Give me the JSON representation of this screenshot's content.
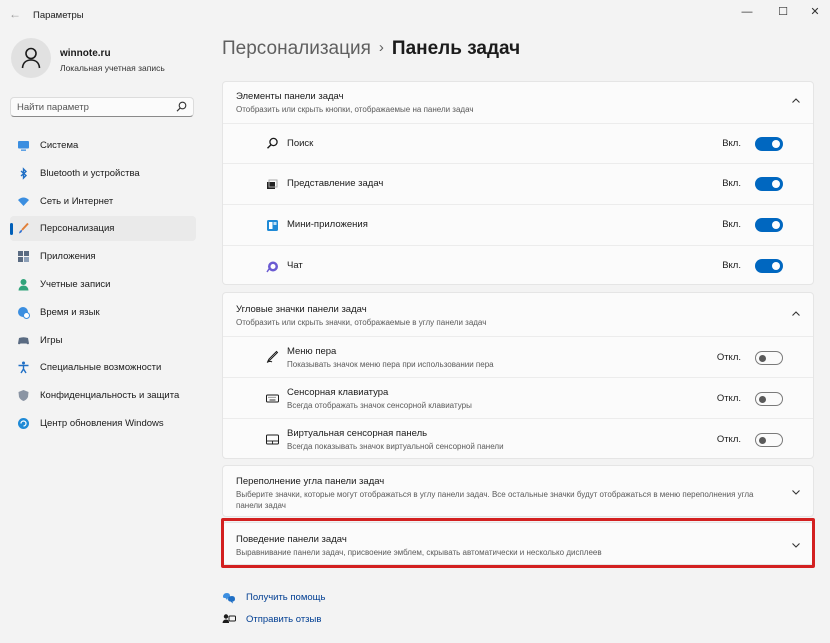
{
  "window": {
    "title": "Параметры",
    "controls": {
      "minimize": "—",
      "maximize": "☐",
      "close": "✕"
    }
  },
  "profile": {
    "name": "winnote.ru",
    "account_type": "Локальная учетная запись"
  },
  "search": {
    "placeholder": "Найти параметр"
  },
  "sidebar": {
    "items": [
      {
        "label": "Система",
        "icon": "system-icon"
      },
      {
        "label": "Bluetooth и устройства",
        "icon": "bluetooth-icon"
      },
      {
        "label": "Сеть и Интернет",
        "icon": "wifi-icon"
      },
      {
        "label": "Персонализация",
        "icon": "brush-icon",
        "active": true
      },
      {
        "label": "Приложения",
        "icon": "apps-icon"
      },
      {
        "label": "Учетные записи",
        "icon": "accounts-icon"
      },
      {
        "label": "Время и язык",
        "icon": "globe-clock-icon"
      },
      {
        "label": "Игры",
        "icon": "gamepad-icon"
      },
      {
        "label": "Специальные возможности",
        "icon": "accessibility-icon"
      },
      {
        "label": "Конфиденциальность и защита",
        "icon": "shield-icon"
      },
      {
        "label": "Центр обновления Windows",
        "icon": "update-icon"
      }
    ]
  },
  "breadcrumb": {
    "parent": "Персонализация",
    "separator": "›",
    "current": "Панель задач"
  },
  "sections": {
    "taskbar_items": {
      "title": "Элементы панели задач",
      "description": "Отобразить или скрыть кнопки, отображаемые на панели задач",
      "rows": [
        {
          "label": "Поиск",
          "state": "Вкл.",
          "on": true,
          "icon": "search-icon"
        },
        {
          "label": "Представление задач",
          "state": "Вкл.",
          "on": true,
          "icon": "task-view-icon"
        },
        {
          "label": "Мини-приложения",
          "state": "Вкл.",
          "on": true,
          "icon": "widgets-icon"
        },
        {
          "label": "Чат",
          "state": "Вкл.",
          "on": true,
          "icon": "chat-icon"
        }
      ]
    },
    "corner_icons": {
      "title": "Угловые значки панели задач",
      "description": "Отобразить или скрыть значки, отображаемые в углу панели задач",
      "rows": [
        {
          "label": "Меню пера",
          "description": "Показывать значок меню пера при использовании пера",
          "state": "Откл.",
          "on": false,
          "icon": "pen-icon"
        },
        {
          "label": "Сенсорная клавиатура",
          "description": "Всегда отображать значок сенсорной клавиатуры",
          "state": "Откл.",
          "on": false,
          "icon": "keyboard-icon"
        },
        {
          "label": "Виртуальная сенсорная панель",
          "description": "Всегда показывать значок виртуальной сенсорной панели",
          "state": "Откл.",
          "on": false,
          "icon": "touchpad-icon"
        }
      ]
    },
    "corner_overflow": {
      "title": "Переполнение угла панели задач",
      "description": "Выберите значки, которые могут отображаться в углу панели задач. Все остальные значки будут отображаться в меню переполнения угла панели задач"
    },
    "behaviors": {
      "title": "Поведение панели задач",
      "description": "Выравнивание панели задач, присвоение эмблем, скрывать автоматически и несколько дисплеев"
    }
  },
  "footer": {
    "help": "Получить помощь",
    "feedback": "Отправить отзыв"
  },
  "colors": {
    "accent": "#0067c0",
    "highlight_border": "#d32020",
    "link": "#003e92"
  }
}
